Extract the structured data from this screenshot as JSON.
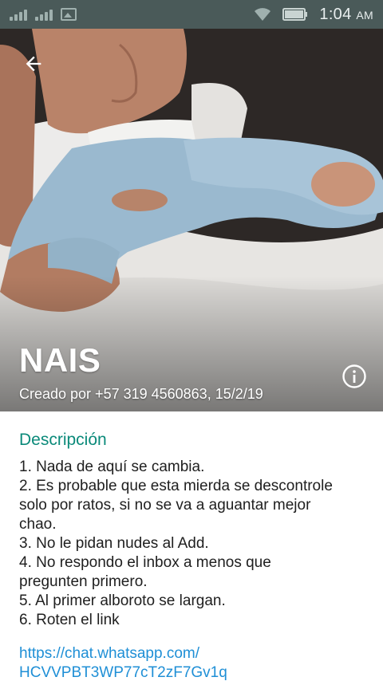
{
  "status_bar": {
    "time": "1:04",
    "ampm": "AM",
    "icons": [
      "signal-icon",
      "gallery-icon",
      "wifi-icon",
      "battery-icon"
    ]
  },
  "header": {
    "title": "NAIS",
    "created_by": "Creado por +57 319 4560863, 15/2/19",
    "back_icon": "arrow-left-icon",
    "info_icon": "info-icon"
  },
  "description": {
    "heading": "Descripción",
    "lines": [
      "1. Nada de aquí se cambia.",
      "2. Es probable que esta mierda se descontrole",
      "solo por ratos, si no se va a aguantar mejor",
      "chao.",
      "3. No le pidan nudes al Add.",
      "4. No respondo el inbox a menos que",
      "pregunten primero.",
      "5. Al primer alboroto se largan.",
      "6. Roten el link"
    ],
    "link_line1": "https://chat.whatsapp.com/",
    "link_line2": "HCVVPBT3WP77cT2zF7Gv1q"
  },
  "colors": {
    "accent": "#0b8a7a",
    "link": "#1f8fd6",
    "status_bar": "#4a5a59"
  }
}
